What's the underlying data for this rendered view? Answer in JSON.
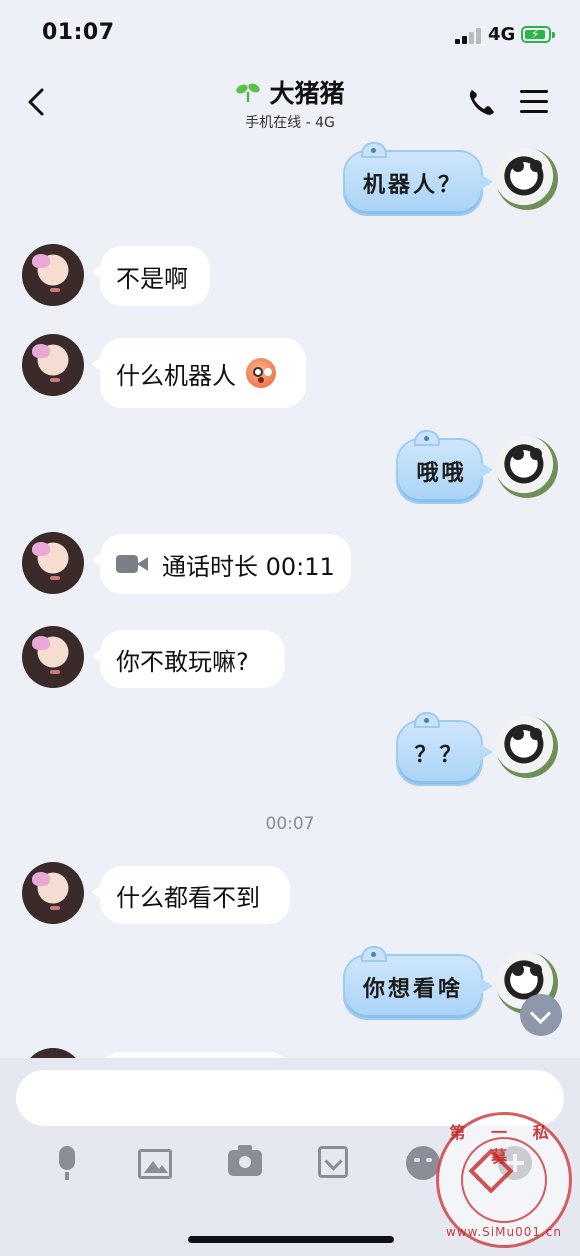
{
  "status_bar": {
    "time": "01:07",
    "network": "4G"
  },
  "header": {
    "title": "大猪猪",
    "subtitle": "手机在线 - 4G"
  },
  "messages": [
    {
      "from": "me",
      "text": "机器人？"
    },
    {
      "from": "them",
      "text": "不是啊"
    },
    {
      "from": "them",
      "text": "什么机器人",
      "emoji": "flushed-face"
    },
    {
      "from": "me",
      "text": "哦哦"
    },
    {
      "from": "them",
      "text": "通话时长 00:11",
      "icon": "video-call"
    },
    {
      "from": "them",
      "text": "你不敢玩嘛?"
    },
    {
      "from": "me",
      "text": "？？"
    },
    {
      "from": "them",
      "text": "什么都看不到"
    },
    {
      "from": "me",
      "text": "你想看啥"
    }
  ],
  "timestamp": "00:07",
  "input": {
    "placeholder": ""
  },
  "toolbar": [
    "microphone",
    "image",
    "camera",
    "red-packet",
    "sticker",
    "plus"
  ],
  "watermark": {
    "top_text": "第 一 私 募",
    "bottom_text": "www.SiMu001.cn"
  },
  "colors": {
    "background": "#eef0f7",
    "bubble_in": "#ffffff",
    "bubble_out": "#b7dbf8",
    "icon_gray": "#8b8e97"
  }
}
